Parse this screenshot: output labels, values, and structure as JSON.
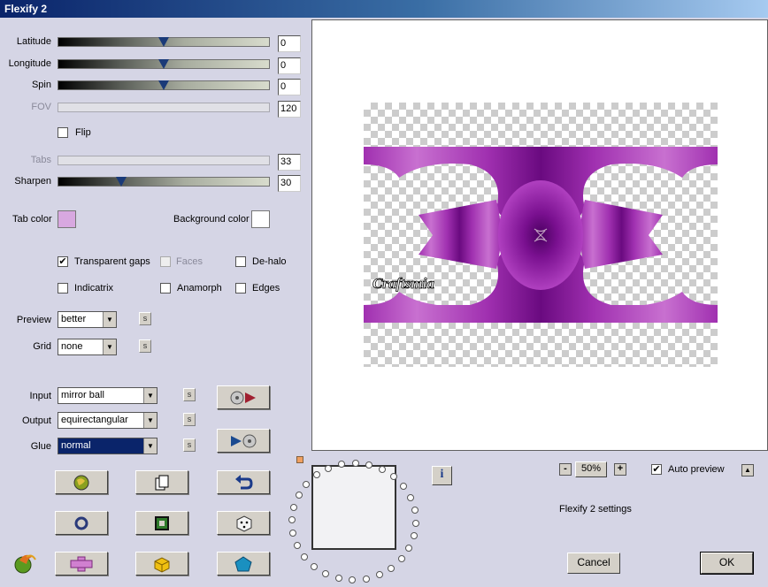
{
  "window": {
    "title": "Flexify 2"
  },
  "sliders": [
    {
      "label": "Latitude",
      "value": "0",
      "thumb": 0.5,
      "disabled": false
    },
    {
      "label": "Longitude",
      "value": "0",
      "thumb": 0.5,
      "disabled": false
    },
    {
      "label": "Spin",
      "value": "0",
      "thumb": 0.5,
      "disabled": false
    },
    {
      "label": "FOV",
      "value": "120",
      "thumb": null,
      "disabled": true
    },
    {
      "label": "Tabs",
      "value": "33",
      "thumb": null,
      "disabled": true
    },
    {
      "label": "Sharpen",
      "value": "30",
      "thumb": 0.3,
      "disabled": false
    }
  ],
  "flip": {
    "label": "Flip",
    "checked": false
  },
  "colors": {
    "tab_color_label": "Tab color",
    "tab_color": "#d8a8e0",
    "background_color_label": "Background color",
    "background_color": "#ffffff"
  },
  "options": {
    "transparent_gaps": {
      "label": "Transparent gaps",
      "checked": true
    },
    "faces": {
      "label": "Faces",
      "checked": false
    },
    "de_halo": {
      "label": "De-halo",
      "checked": false
    },
    "indicatrix": {
      "label": "Indicatrix",
      "checked": false
    },
    "anamorph": {
      "label": "Anamorph",
      "checked": false
    },
    "edges": {
      "label": "Edges",
      "checked": false
    }
  },
  "dropdowns": {
    "preview": {
      "label": "Preview",
      "value": "better"
    },
    "grid": {
      "label": "Grid",
      "value": "none"
    },
    "input": {
      "label": "Input",
      "value": "mirror ball"
    },
    "output": {
      "label": "Output",
      "value": "equirectangular"
    },
    "glue": {
      "label": "Glue",
      "value": "normal"
    }
  },
  "s_button_label": "s",
  "zoom": {
    "minus": "-",
    "level": "50%",
    "plus": "+"
  },
  "auto_preview": {
    "label": "Auto preview",
    "checked": true,
    "up_label": "▲"
  },
  "settings_name": "Flexify 2 settings",
  "info_label": "i",
  "buttons": {
    "cancel": "Cancel",
    "ok": "OK"
  },
  "theme": {
    "accent": "#0a246a",
    "face": "#d5d5e5",
    "button": "#d4d0c8",
    "purple": "#a030b0"
  }
}
